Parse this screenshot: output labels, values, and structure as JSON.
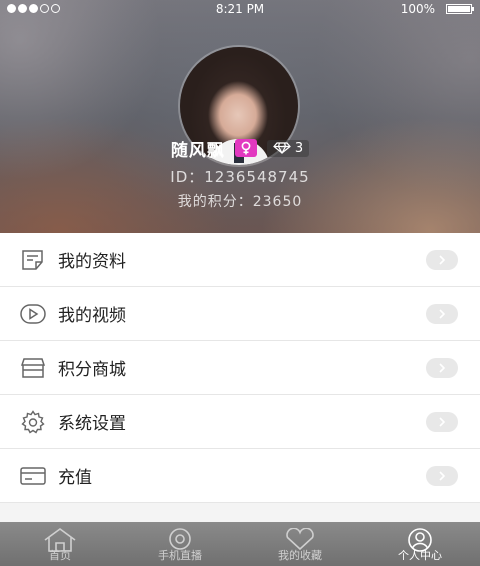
{
  "status_bar": {
    "time": "8:21 PM",
    "battery": "100%",
    "signal_dots_filled": 3,
    "signal_dots_total": 5
  },
  "profile": {
    "name": "随风飘",
    "gender_icon": "female-icon",
    "diamond_count": "3",
    "user_id": "ID：1236548745",
    "points": "我的积分：23650"
  },
  "menu": [
    {
      "label": "我的资料",
      "icon": "profile-doc-icon"
    },
    {
      "label": "我的视频",
      "icon": "video-play-icon"
    },
    {
      "label": "积分商城",
      "icon": "store-icon"
    },
    {
      "label": "系统设置",
      "icon": "gear-icon"
    },
    {
      "label": "充值",
      "icon": "card-icon"
    }
  ],
  "tabbar": [
    {
      "label": "首页",
      "icon": "home-icon"
    },
    {
      "label": "手机直播",
      "icon": "live-icon"
    },
    {
      "label": "我的收藏",
      "icon": "heart-icon"
    },
    {
      "label": "个人中心",
      "icon": "user-icon",
      "active": true
    }
  ],
  "colors": {
    "gender_badge": "#e238c0",
    "tabbar": "#7a7a7a"
  }
}
